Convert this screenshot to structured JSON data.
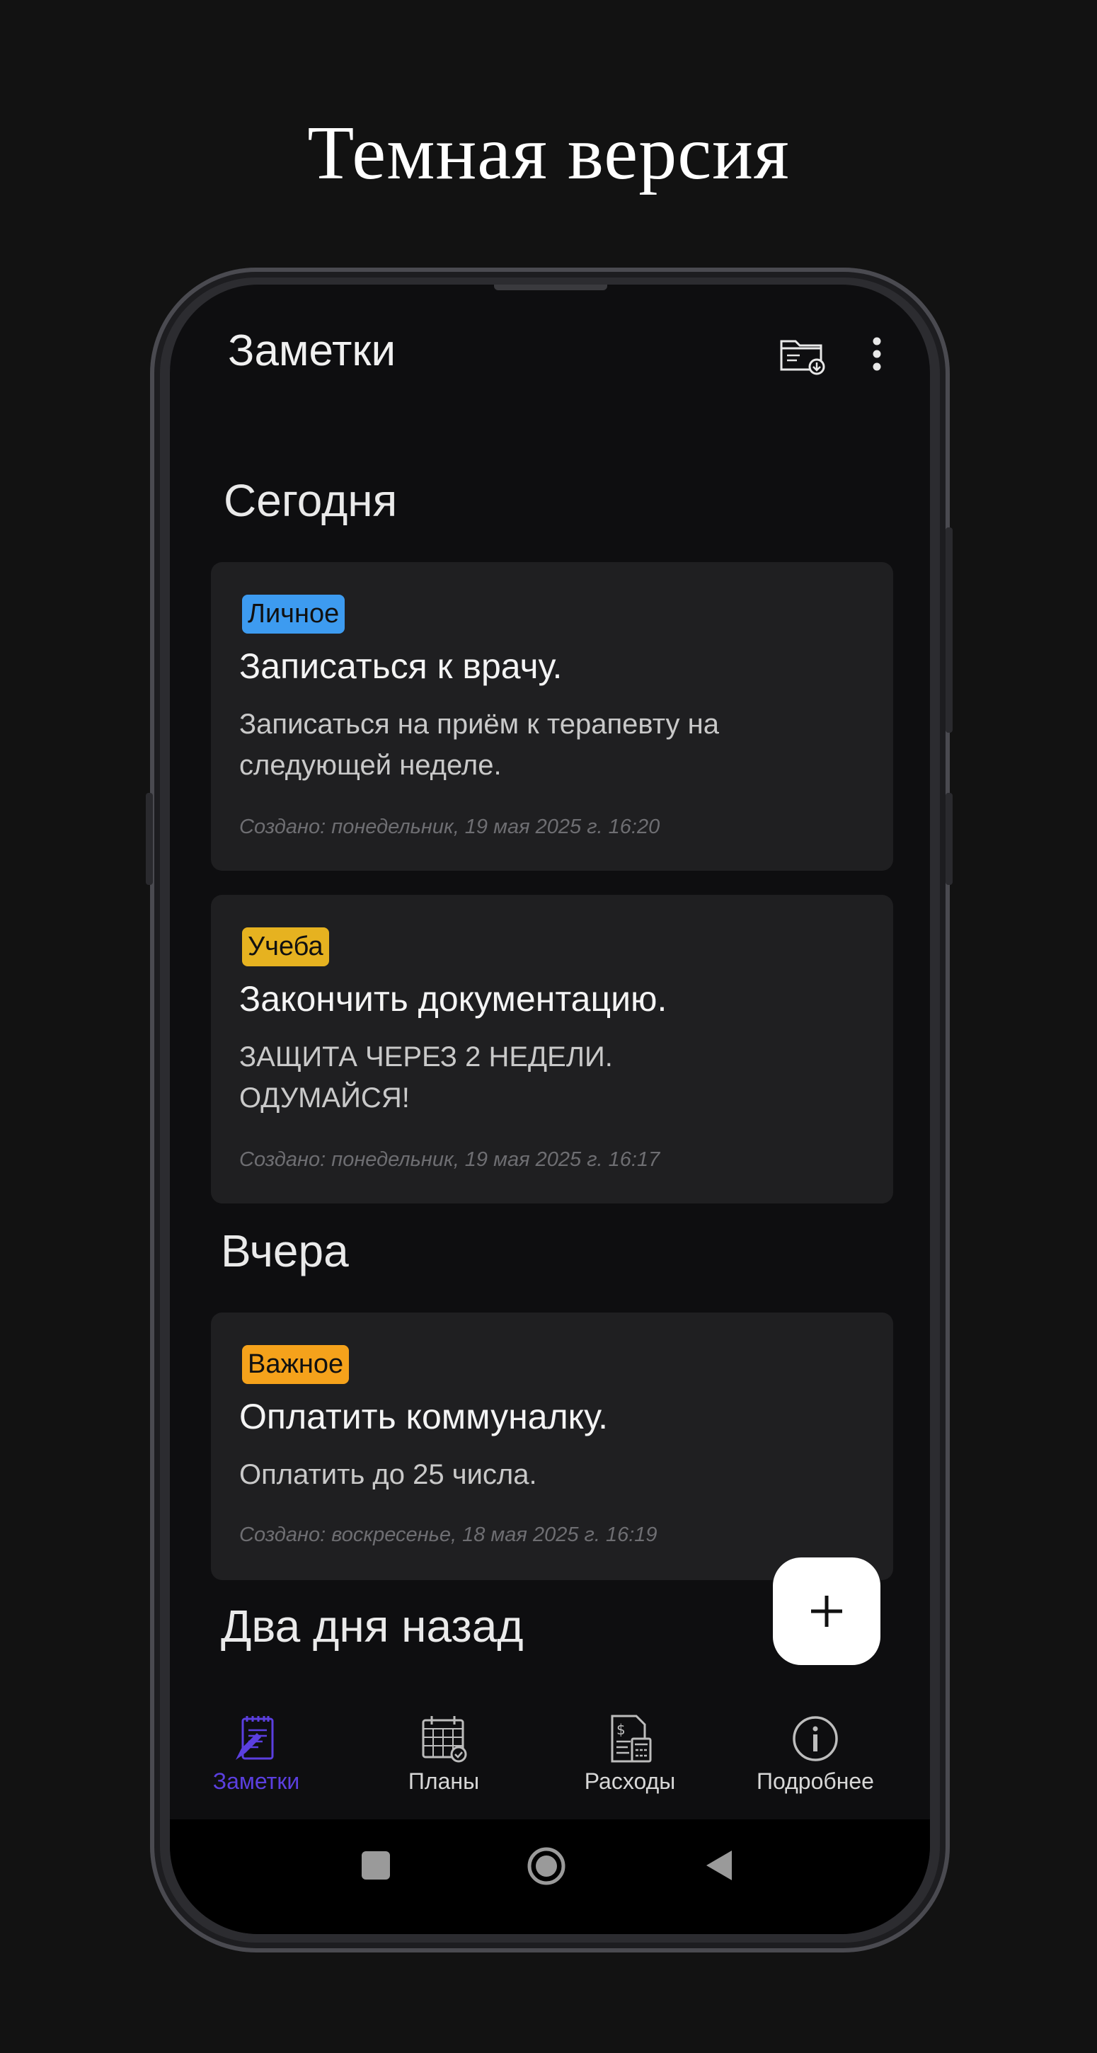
{
  "promo": {
    "title": "Темная версия"
  },
  "app_bar": {
    "title": "Заметки",
    "actions": [
      "folder-download-icon",
      "more-vert-icon"
    ]
  },
  "sections": [
    {
      "header": "Сегодня",
      "notes": [
        {
          "tag": "Личное",
          "tag_color": "#3d9bf0",
          "title": "Записаться к врачу.",
          "body": [
            "Записаться на приём к терапевту на",
            "следующей неделе."
          ],
          "created": "Создано: понедельник, 19 мая 2025 г. 16:20"
        },
        {
          "tag": "Учеба",
          "tag_color": "#e6b220",
          "title": "Закончить документацию.",
          "body": [
            "ЗАЩИТА ЧЕРЕЗ 2 НЕДЕЛИ.",
            "ОДУМАЙСЯ!"
          ],
          "created": "Создано: понедельник, 19 мая 2025 г. 16:17"
        }
      ]
    },
    {
      "header": "Вчера",
      "notes": [
        {
          "tag": "Важное",
          "tag_color": "#f5a21b",
          "title": "Оплатить коммуналку.",
          "body": [
            "Оплатить до 25 числа."
          ],
          "created": "Создано: воскресенье, 18 мая 2025 г. 16:19"
        }
      ]
    },
    {
      "header": "Два дня назад",
      "notes": []
    }
  ],
  "fab": {
    "icon": "plus-icon"
  },
  "bottom_nav": [
    {
      "label": "Заметки",
      "icon": "notes-icon",
      "active": true
    },
    {
      "label": "Планы",
      "icon": "calendar-icon",
      "active": false
    },
    {
      "label": "Расходы",
      "icon": "expenses-icon",
      "active": false
    },
    {
      "label": "Подробнее",
      "icon": "info-icon",
      "active": false
    }
  ],
  "system_nav": [
    "square-icon",
    "circle-icon",
    "back-triangle-icon"
  ],
  "colors": {
    "accent": "#5b3fe0",
    "background": "#0e0e10",
    "card": "#1f1f21"
  }
}
